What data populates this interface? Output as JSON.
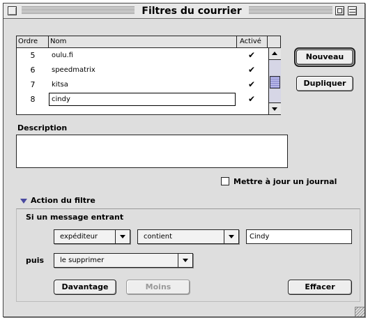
{
  "window": {
    "title": "Filtres du courrier"
  },
  "table": {
    "headers": {
      "ordre": "Ordre",
      "nom": "Nom",
      "active": "Activé"
    },
    "rows": [
      {
        "order": "5",
        "name": "oulu.fi",
        "check": "✔"
      },
      {
        "order": "6",
        "name": "speedmatrix",
        "check": "✔"
      },
      {
        "order": "7",
        "name": "kitsa",
        "check": "✔"
      },
      {
        "order": "8",
        "name": "cindy",
        "check": "✔"
      }
    ]
  },
  "buttons": {
    "nouveau": "Nouveau",
    "dupliquer": "Dupliquer",
    "davantage": "Davantage",
    "moins": "Moins",
    "effacer": "Effacer"
  },
  "description": {
    "label": "Description",
    "value": ""
  },
  "journal": {
    "label": "Mettre à jour un journal",
    "checked": false
  },
  "action": {
    "section_label": "Action du filtre",
    "condition_label": "Si un message entrant",
    "field_select": "expéditeur",
    "operator_select": "contient",
    "value_input": "Cindy",
    "then_label": "puis",
    "action_select": "le supprimer"
  },
  "colors": {
    "window_bg": "#dedede",
    "scroll_thumb": "#b7b7e8",
    "disclosure": "#4a4aa0"
  }
}
